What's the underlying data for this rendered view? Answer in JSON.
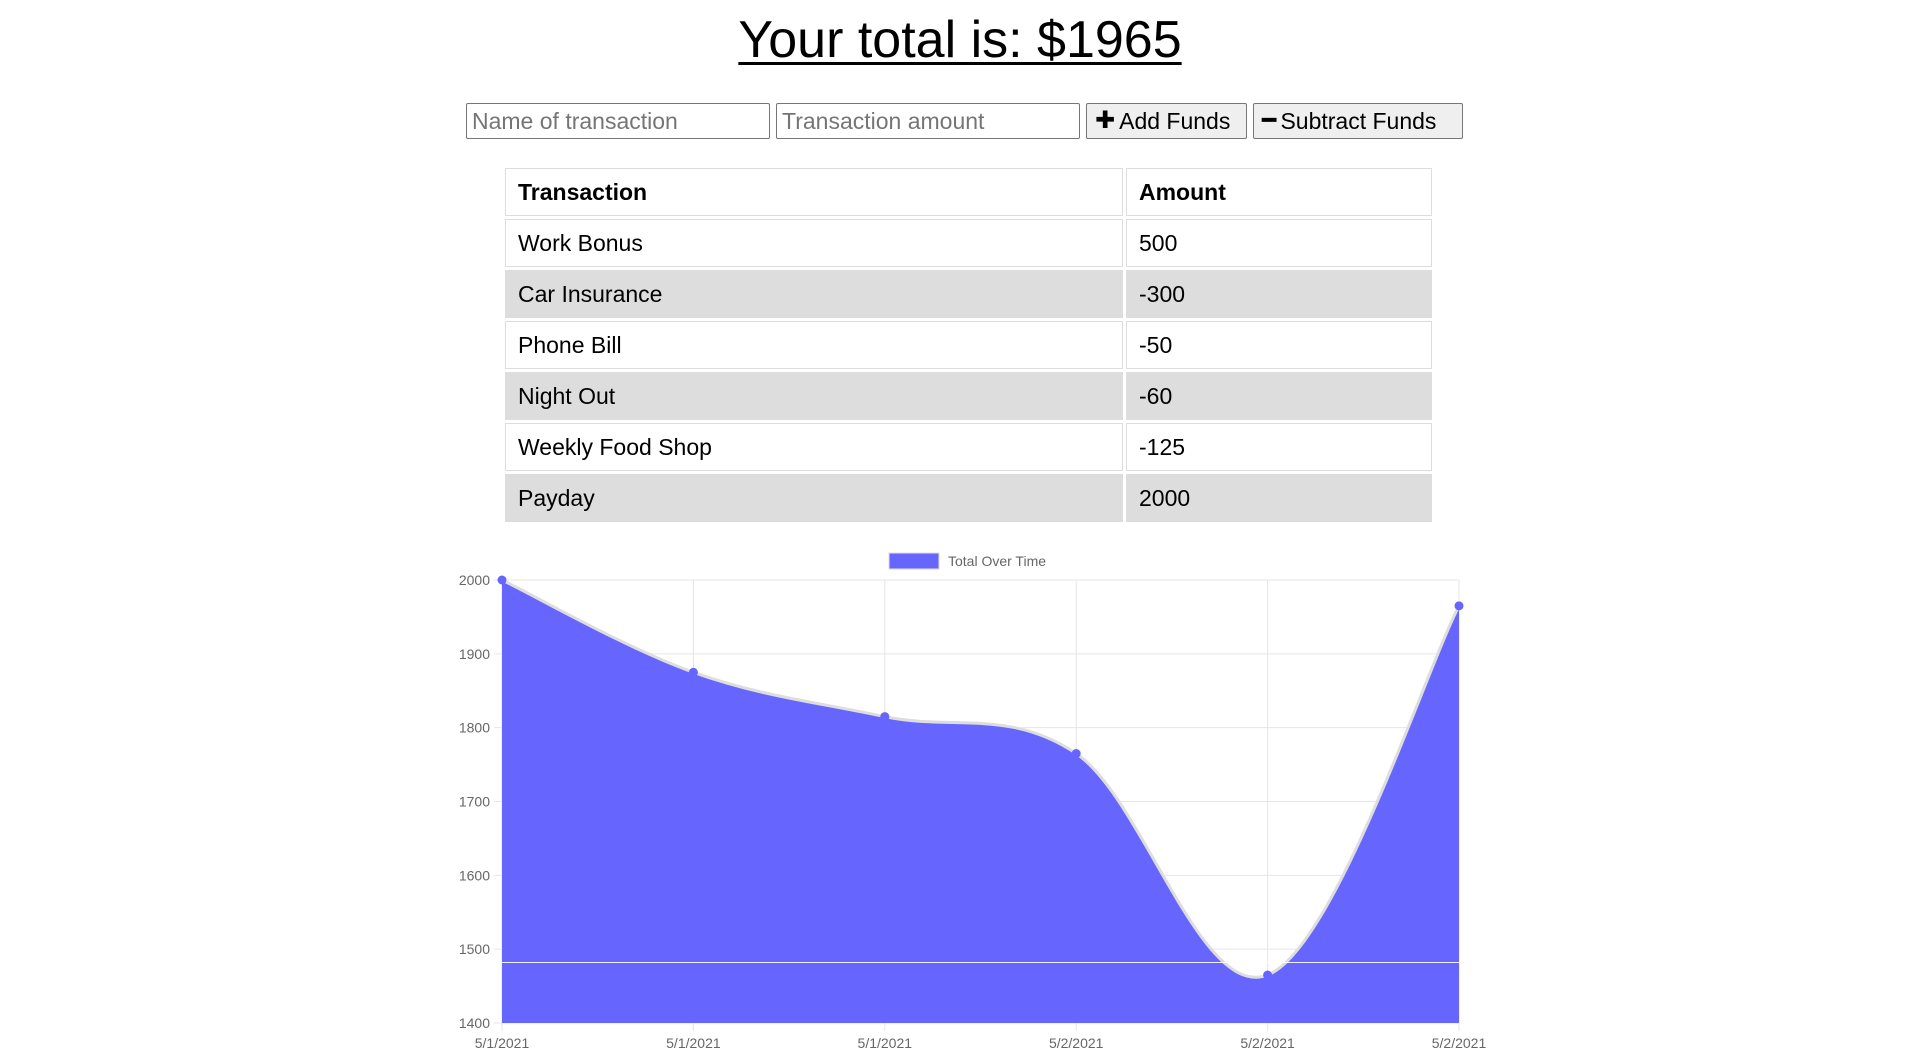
{
  "header": {
    "title": "Your total is: $1965"
  },
  "form": {
    "name_placeholder": "Name of transaction",
    "amount_placeholder": "Transaction amount",
    "add_label": "Add Funds",
    "add_icon": "plus-icon",
    "subtract_label": "Subtract Funds",
    "subtract_icon": "minus-icon"
  },
  "table": {
    "headers": [
      "Transaction",
      "Amount"
    ],
    "rows": [
      {
        "name": "Work Bonus",
        "amount": "500"
      },
      {
        "name": "Car Insurance",
        "amount": "-300"
      },
      {
        "name": "Phone Bill",
        "amount": "-50"
      },
      {
        "name": "Night Out",
        "amount": "-60"
      },
      {
        "name": "Weekly Food Shop",
        "amount": "-125"
      },
      {
        "name": "Payday",
        "amount": "2000"
      }
    ]
  },
  "chart_data": {
    "type": "area",
    "x": [
      "5/1/2021",
      "5/1/2021",
      "5/1/2021",
      "5/2/2021",
      "5/2/2021",
      "5/2/2021"
    ],
    "series": [
      {
        "name": "Total Over Time",
        "values": [
          2000,
          1875,
          1815,
          1765,
          1465,
          1965
        ]
      }
    ],
    "ylim": [
      1400,
      2000
    ],
    "yticks": [
      1400,
      1500,
      1600,
      1700,
      1800,
      1900,
      2000
    ],
    "grid": true,
    "legend": "top",
    "fill_color": "#6666ff",
    "line_color": "#dddddd",
    "point_color": "#6666ff"
  }
}
